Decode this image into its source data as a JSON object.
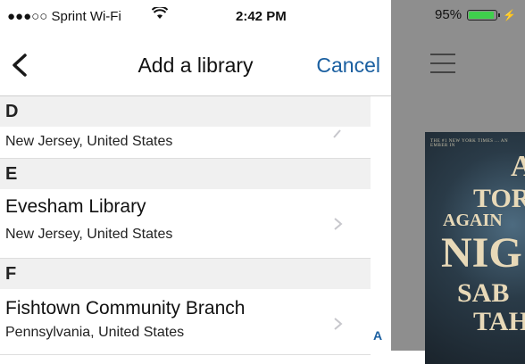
{
  "status": {
    "carrier": "●●●○○ Sprint Wi-Fi",
    "time": "2:42 PM",
    "battery": "95%"
  },
  "nav": {
    "title": "Add a library",
    "cancel_label": "Cancel"
  },
  "sections": [
    {
      "letter": "D",
      "rows": [
        {
          "name": "",
          "place": "New Jersey, United States"
        }
      ]
    },
    {
      "letter": "E",
      "rows": [
        {
          "name": "Evesham Library",
          "place": "New Jersey, United States"
        }
      ]
    },
    {
      "letter": "F",
      "rows": [
        {
          "name": "Fishtown Community Branch",
          "place": "Pennsylvania, United States"
        }
      ]
    }
  ],
  "index_letters": [
    "A"
  ],
  "book": {
    "tagline": "THE #1 NEW YORK TIMES ... AN EMBER IN",
    "title_lines": [
      "A",
      "TOR",
      "AGAIN",
      "NIG",
      "SAB",
      "TAH"
    ]
  },
  "colors": {
    "accent": "#1a5fa0",
    "section_bg": "#f0f0f0",
    "battery_fill": "#3fd04c"
  }
}
